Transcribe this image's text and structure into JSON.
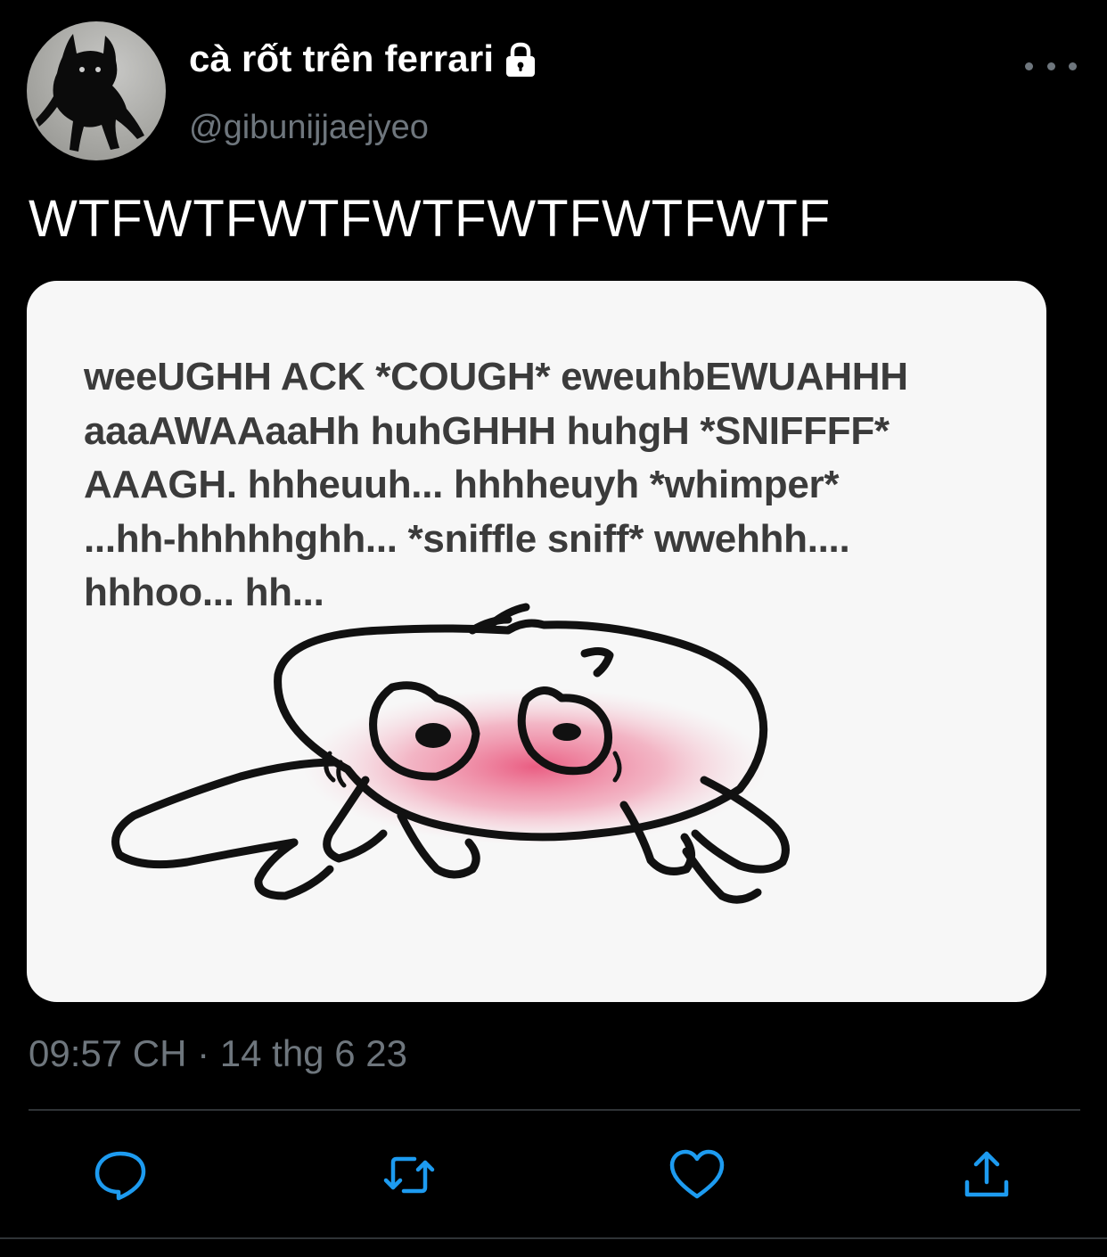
{
  "tweet": {
    "display_name": "cà rốt trên ferrari",
    "handle": "@gibunijjaejyeo",
    "text": "WTFWTFWTFWTFWTFWTFWTF",
    "timestamp": "09:57 CH · 14 thg 6 23",
    "protected": true
  },
  "media": {
    "text_lines": [
      "weeUGHH ACK *COUGH* eweuhbEWUAHHH",
      "aaaAWAAaaHh huhGHHH huhgH *SNIFFFF*",
      "AAAGH. hhheuuh... hhhheuyh *whimper*",
      "...hh-hhhhhghh... *sniffle sniff* wwehhh....",
      "hhhoo... hh..."
    ]
  },
  "icons": {
    "header": [
      "lock-icon",
      "more-icon"
    ],
    "actions": [
      "reply-icon",
      "retweet-icon",
      "like-icon",
      "share-icon"
    ]
  },
  "colors": {
    "background": "#000000",
    "text_primary": "#ffffff",
    "text_secondary": "#6e767d",
    "divider": "#2f3336",
    "media_background": "#f7f7f7",
    "blush": "#ec6e8e"
  }
}
